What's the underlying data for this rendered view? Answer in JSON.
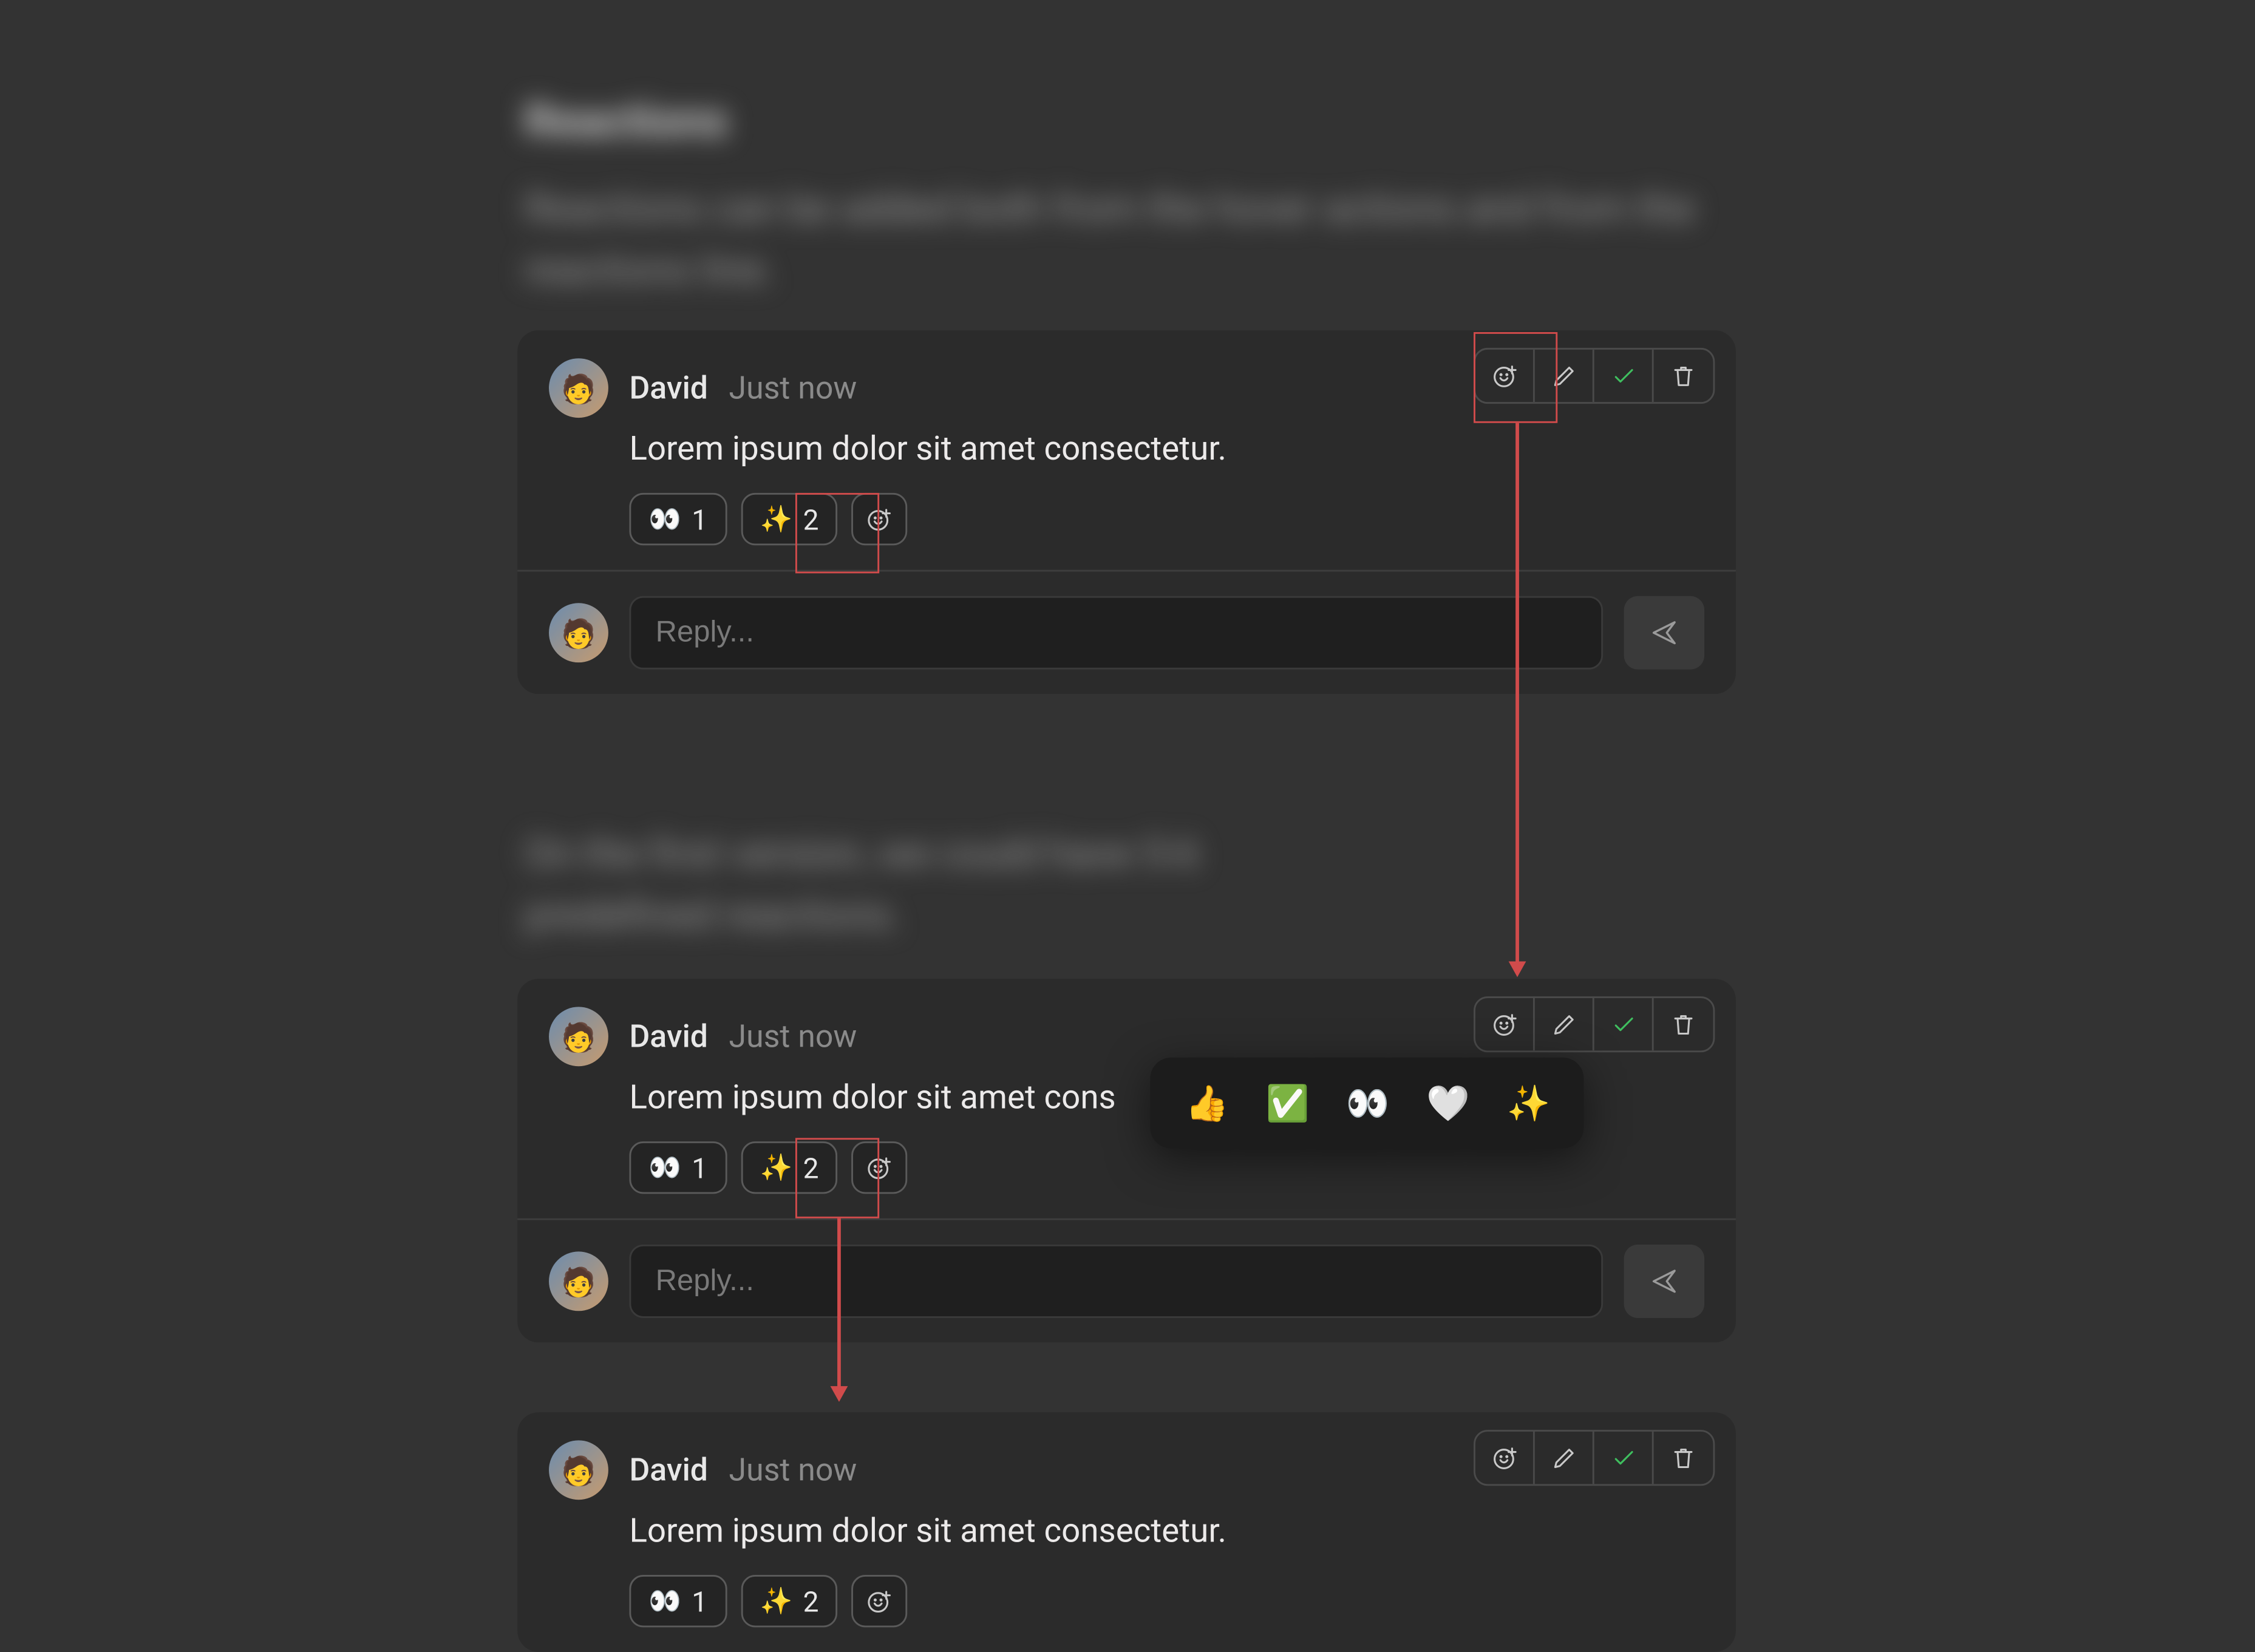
{
  "heading": "Reactions",
  "intro": "Reactions can be added both from the hover actions and from the reactions line.",
  "note": "On the first version, we could have 5-6 predefined reactions.",
  "author": "David",
  "timestamp": "Just now",
  "message": "Lorem ipsum dolor sit amet consectetur.",
  "message_truncated": "Lorem ipsum dolor sit amet cons",
  "reactions": {
    "eyes": {
      "emoji": "👀",
      "count": "1"
    },
    "sparkles": {
      "emoji": "✨",
      "count": "2"
    }
  },
  "reply_placeholder": "Reply...",
  "popover_options": [
    "👍",
    "✅",
    "👀",
    "🤍",
    "✨"
  ]
}
